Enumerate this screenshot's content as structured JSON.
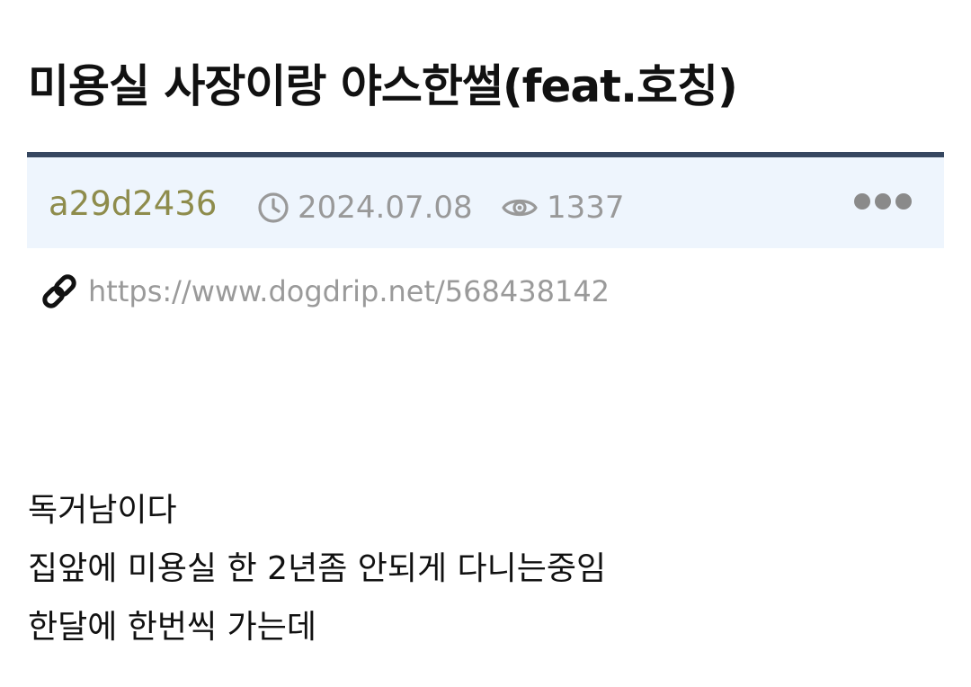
{
  "post": {
    "title": "미용실 사장이랑 야스한썰(feat.호칭)",
    "author": "a29d2436",
    "date": "2024.07.08",
    "views": "1337",
    "url": "https://www.dogdrip.net/568438142",
    "body": [
      "독거남이다",
      "집앞에 미용실 한 2년좀 안되게 다니는중임",
      "한달에 한번씩 가는데"
    ]
  },
  "icons": {
    "date": "clock-icon",
    "views": "eye-icon",
    "more": "more-dots-icon",
    "link": "link-icon"
  },
  "colors": {
    "author": "#8e8c4c",
    "meta_bar_background": "#eef5fd",
    "meta_bar_border": "#364760",
    "meta_text": "#999999"
  }
}
